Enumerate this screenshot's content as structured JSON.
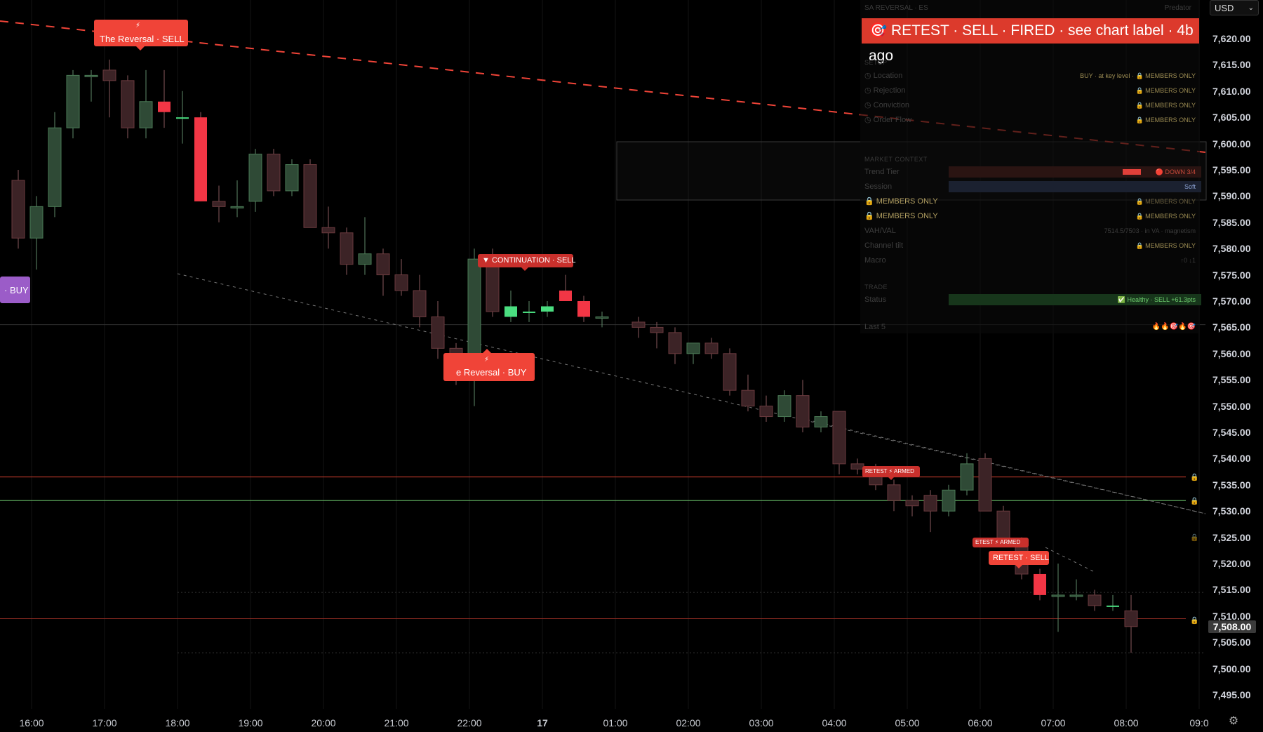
{
  "currency": {
    "label": "USD"
  },
  "price_axis": {
    "ticks": [
      "7,620.00",
      "7,615.00",
      "7,610.00",
      "7,605.00",
      "7,600.00",
      "7,595.00",
      "7,590.00",
      "7,585.00",
      "7,580.00",
      "7,575.00",
      "7,570.00",
      "7,565.00",
      "7,560.00",
      "7,555.00",
      "7,550.00",
      "7,545.00",
      "7,540.00",
      "7,535.00",
      "7,530.00",
      "7,525.00",
      "7,520.00",
      "7,515.00",
      "7,510.00",
      "7,505.00",
      "7,500.00",
      "7,495.00"
    ],
    "current": "7,508.00"
  },
  "time_axis": {
    "ticks": [
      "16:00",
      "17:00",
      "18:00",
      "19:00",
      "20:00",
      "21:00",
      "22:00",
      "17",
      "01:00",
      "02:00",
      "03:00",
      "04:00",
      "05:00",
      "06:00",
      "07:00",
      "08:00",
      "09:0"
    ],
    "bold_index": 7
  },
  "chart_labels": {
    "reversal_sell_top": "The Reversal · SELL",
    "buy_left": "· BUY",
    "continuation_sell": "▼ CONTINUATION · SELL",
    "reversal_buy": "e Reversal · BUY",
    "retest_armed_1": "RETEST ⚡ ARMED",
    "retest_armed_2": "ETEST ⚡ ARMED",
    "retest_sell": "RETEST · SELL",
    "lightning": "⚡"
  },
  "panel": {
    "header_left": "SA REVERSAL · ES",
    "header_right": "Predator",
    "alert": "RETEST · SELL · FIRED · see chart label · 4b ago",
    "setup_title": "SETUP",
    "setup_rows": [
      {
        "label": "Location",
        "value": "BUY · at key level · 🔒 MEMBERS ONLY"
      },
      {
        "label": "Rejection",
        "value": "🔒 MEMBERS ONLY"
      },
      {
        "label": "Conviction",
        "value": "🔒 MEMBERS ONLY"
      },
      {
        "label": "Order Flow",
        "value": "🔒 MEMBERS ONLY"
      }
    ],
    "market_title": "MARKET CONTEXT",
    "market_rows": [
      {
        "label": "Trend Tier",
        "value": "🔴 DOWN 3/4"
      },
      {
        "label": "Session",
        "value": "Soft"
      },
      {
        "label": "🔒 MEMBERS ONLY",
        "value": "🔒 MEMBERS ONLY"
      },
      {
        "label": "🔒 MEMBERS ONLY",
        "value": "🔒 MEMBERS ONLY"
      },
      {
        "label": "VAH/VAL",
        "value": "7514.5/7503 · in VA · magnetism"
      },
      {
        "label": "Channel tilt",
        "value": "🔒 MEMBERS ONLY"
      },
      {
        "label": "Macro",
        "value": "↑0 ↓1"
      }
    ],
    "trade_title": "TRADE",
    "trade_rows": [
      {
        "label": "Status",
        "value": "✅ Healthy · SELL +61.3pts"
      },
      {
        "label": "Last 5",
        "value": "🔥🔥🎯🔥🎯"
      }
    ]
  },
  "colors": {
    "bear": "#f23645",
    "bull": "#4ade80",
    "red_level": "#c0392b",
    "green_level": "#5aa35a",
    "panel_alert": "#dc3a2c"
  },
  "chart_data": {
    "type": "candlestick",
    "candles": [
      {
        "time": "15:45",
        "o": 7593,
        "h": 7595,
        "l": 7580,
        "c": 7582
      },
      {
        "time": "16:00",
        "o": 7582,
        "h": 7590,
        "l": 7576,
        "c": 7588
      },
      {
        "time": "16:15",
        "o": 7588,
        "h": 7606,
        "l": 7586,
        "c": 7603
      },
      {
        "time": "16:30",
        "o": 7603,
        "h": 7614,
        "l": 7601,
        "c": 7613
      },
      {
        "time": "16:45",
        "o": 7613,
        "h": 7614,
        "l": 7608,
        "c": 7613
      },
      {
        "time": "17:00",
        "o": 7614,
        "h": 7616,
        "l": 7605,
        "c": 7612
      },
      {
        "time": "17:15",
        "o": 7612,
        "h": 7613,
        "l": 7601,
        "c": 7603
      },
      {
        "time": "17:30",
        "o": 7603,
        "h": 7614,
        "l": 7601,
        "c": 7608
      },
      {
        "time": "17:45",
        "o": 7608,
        "h": 7614,
        "l": 7603,
        "c": 7606
      },
      {
        "time": "18:00",
        "o": 7605,
        "h": 7610,
        "l": 7600,
        "c": 7605
      },
      {
        "time": "18:15",
        "o": 7605,
        "h": 7606,
        "l": 7589,
        "c": 7589
      },
      {
        "time": "18:30",
        "o": 7589,
        "h": 7592,
        "l": 7585,
        "c": 7588
      },
      {
        "time": "18:45",
        "o": 7588,
        "h": 7593,
        "l": 7586,
        "c": 7588
      },
      {
        "time": "19:00",
        "o": 7589,
        "h": 7599,
        "l": 7587,
        "c": 7598
      },
      {
        "time": "19:15",
        "o": 7598,
        "h": 7599,
        "l": 7590,
        "c": 7591
      },
      {
        "time": "19:30",
        "o": 7591,
        "h": 7597,
        "l": 7590,
        "c": 7596
      },
      {
        "time": "19:45",
        "o": 7596,
        "h": 7597,
        "l": 7584,
        "c": 7584
      },
      {
        "time": "20:00",
        "o": 7584,
        "h": 7588,
        "l": 7580,
        "c": 7583
      },
      {
        "time": "20:15",
        "o": 7583,
        "h": 7584,
        "l": 7575,
        "c": 7577
      },
      {
        "time": "20:30",
        "o": 7577,
        "h": 7586,
        "l": 7575,
        "c": 7579
      },
      {
        "time": "20:45",
        "o": 7579,
        "h": 7580,
        "l": 7571,
        "c": 7575
      },
      {
        "time": "21:00",
        "o": 7575,
        "h": 7578,
        "l": 7571,
        "c": 7572
      },
      {
        "time": "21:15",
        "o": 7572,
        "h": 7575,
        "l": 7565,
        "c": 7567
      },
      {
        "time": "21:30",
        "o": 7567,
        "h": 7570,
        "l": 7559,
        "c": 7561
      },
      {
        "time": "21:45",
        "o": 7561,
        "h": 7562,
        "l": 7554,
        "c": 7555
      },
      {
        "time": "22:00",
        "o": 7555,
        "h": 7580,
        "l": 7550,
        "c": 7578
      },
      {
        "time": "22:15",
        "o": 7578,
        "h": 7580,
        "l": 7567,
        "c": 7568
      },
      {
        "time": "22:30",
        "o": 7567,
        "h": 7572,
        "l": 7566,
        "c": 7569
      },
      {
        "time": "22:45",
        "o": 7568,
        "h": 7570,
        "l": 7566,
        "c": 7568
      },
      {
        "time": "23:00",
        "o": 7568,
        "h": 7570,
        "l": 7567,
        "c": 7569
      },
      {
        "time": "23:15",
        "o": 7572,
        "h": 7575,
        "l": 7570,
        "c": 7570
      },
      {
        "time": "23:30",
        "o": 7570,
        "h": 7571,
        "l": 7566,
        "c": 7567
      },
      {
        "time": "23:45",
        "o": 7567,
        "h": 7568,
        "l": 7565,
        "c": 7567
      },
      {
        "time": "00:15",
        "o": 7566,
        "h": 7567,
        "l": 7563,
        "c": 7565
      },
      {
        "time": "00:30",
        "o": 7565,
        "h": 7566,
        "l": 7561,
        "c": 7564
      },
      {
        "time": "00:45",
        "o": 7564,
        "h": 7565,
        "l": 7558,
        "c": 7560
      },
      {
        "time": "01:00",
        "o": 7560,
        "h": 7562,
        "l": 7558,
        "c": 7562
      },
      {
        "time": "01:15",
        "o": 7562,
        "h": 7563,
        "l": 7559,
        "c": 7560
      },
      {
        "time": "01:30",
        "o": 7560,
        "h": 7561,
        "l": 7552,
        "c": 7553
      },
      {
        "time": "01:45",
        "o": 7553,
        "h": 7556,
        "l": 7549,
        "c": 7550
      },
      {
        "time": "02:00",
        "o": 7550,
        "h": 7552,
        "l": 7547,
        "c": 7548
      },
      {
        "time": "02:15",
        "o": 7548,
        "h": 7553,
        "l": 7547,
        "c": 7552
      },
      {
        "time": "02:30",
        "o": 7552,
        "h": 7555,
        "l": 7545,
        "c": 7546
      },
      {
        "time": "02:45",
        "o": 7546,
        "h": 7549,
        "l": 7545,
        "c": 7548
      },
      {
        "time": "03:00",
        "o": 7549,
        "h": 7549,
        "l": 7537,
        "c": 7539
      },
      {
        "time": "03:15",
        "o": 7539,
        "h": 7540,
        "l": 7537,
        "c": 7538
      },
      {
        "time": "03:30",
        "o": 7538,
        "h": 7539,
        "l": 7534,
        "c": 7535
      },
      {
        "time": "03:45",
        "o": 7535,
        "h": 7536,
        "l": 7530,
        "c": 7532
      },
      {
        "time": "04:00",
        "o": 7532,
        "h": 7533,
        "l": 7529,
        "c": 7531
      },
      {
        "time": "04:15",
        "o": 7533,
        "h": 7534,
        "l": 7526,
        "c": 7530
      },
      {
        "time": "04:30",
        "o": 7530,
        "h": 7535,
        "l": 7529,
        "c": 7534
      },
      {
        "time": "04:45",
        "o": 7534,
        "h": 7541,
        "l": 7533,
        "c": 7539
      },
      {
        "time": "05:00",
        "o": 7540,
        "h": 7541,
        "l": 7530,
        "c": 7530
      },
      {
        "time": "05:15",
        "o": 7530,
        "h": 7531,
        "l": 7524,
        "c": 7524
      },
      {
        "time": "05:30",
        "o": 7524,
        "h": 7525,
        "l": 7517,
        "c": 7518
      },
      {
        "time": "05:45",
        "o": 7518,
        "h": 7519,
        "l": 7513,
        "c": 7514
      },
      {
        "time": "06:00",
        "o": 7514,
        "h": 7520,
        "l": 7507,
        "c": 7514
      },
      {
        "time": "06:15",
        "o": 7514,
        "h": 7517,
        "l": 7513,
        "c": 7514
      },
      {
        "time": "06:30",
        "o": 7514,
        "h": 7515,
        "l": 7511,
        "c": 7512
      },
      {
        "time": "06:45",
        "o": 7512,
        "h": 7514,
        "l": 7511,
        "c": 7512
      },
      {
        "time": "07:00",
        "o": 7511,
        "h": 7514,
        "l": 7503,
        "c": 7508
      }
    ]
  }
}
